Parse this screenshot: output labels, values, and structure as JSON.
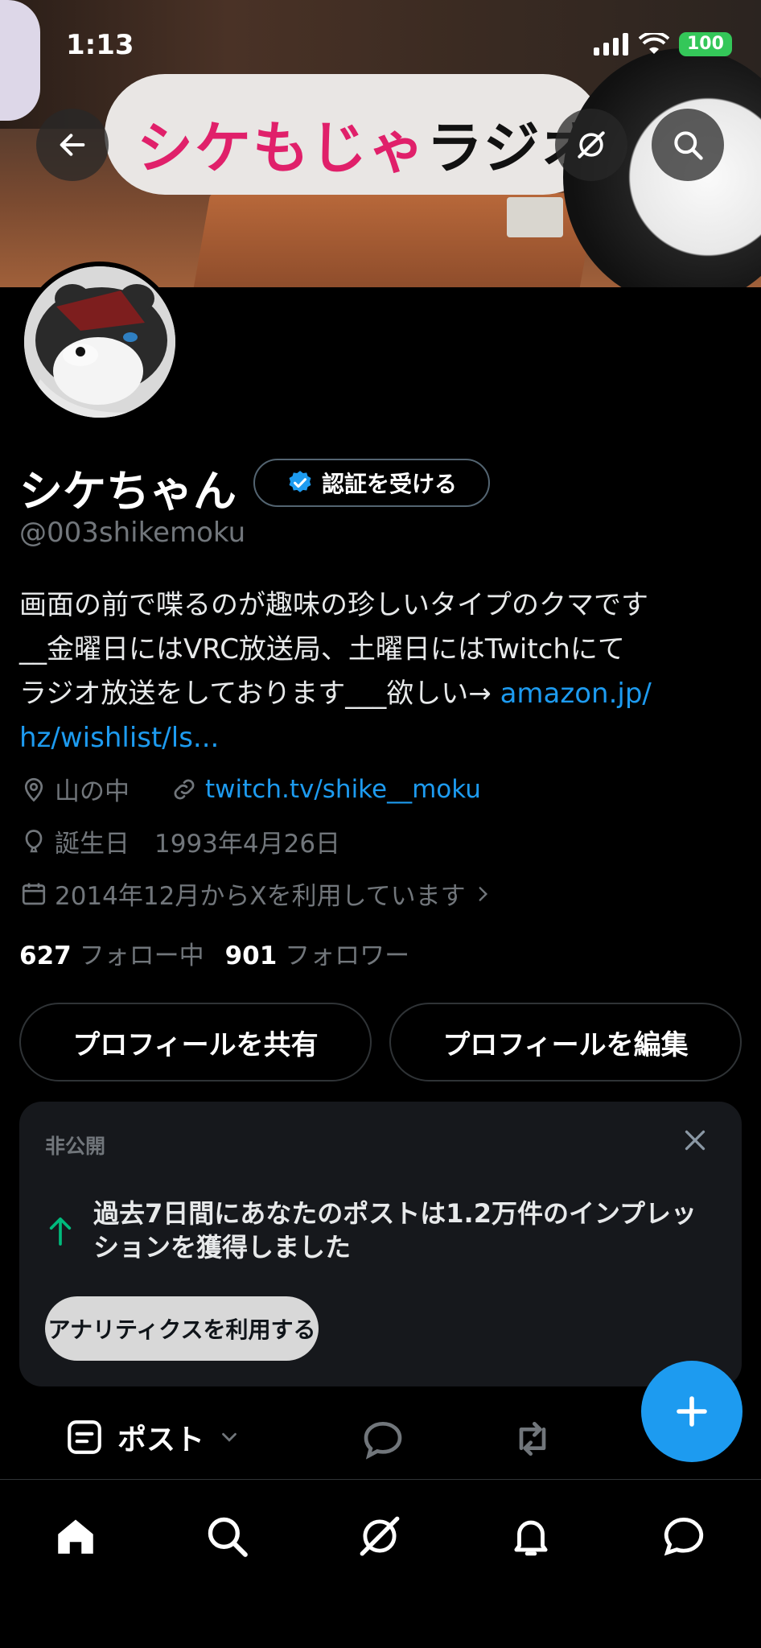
{
  "status_bar": {
    "time": "1:13",
    "battery": "100"
  },
  "banner": {
    "sign_text_pink": "シケもじゃ",
    "sign_text_black": "ラジオ"
  },
  "profile": {
    "name": "シケちゃん",
    "verify_label": "認証を受ける",
    "handle": "@003shikemoku",
    "bio_lines": [
      "画面の前で喋るのが趣味の珍しいタイプのクマです",
      "__金曜日にはVRC放送局、土曜日にはTwitchにて",
      "ラジオ放送をしております___欲しい→ "
    ],
    "bio_link_1": "amazon.jp/",
    "bio_link_2": "hz/wishlist/ls...",
    "location": "山の中",
    "website": "twitch.tv/shike__moku",
    "birthday": "誕生日　1993年4月26日",
    "joined": "2014年12月からXを利用しています",
    "following_count": "627",
    "following_label": "フォロー中",
    "followers_count": "901",
    "followers_label": "フォロワー"
  },
  "actions": {
    "share": "プロフィールを共有",
    "edit": "プロフィールを編集"
  },
  "analytics_card": {
    "title": "非公開",
    "message": "過去7日間にあなたのポストは1.2万件のインプレッションを獲得しました",
    "cta": "アナリティクスを利用する"
  },
  "tabs": {
    "post_label": "ポスト"
  },
  "colors": {
    "accent": "#1d9bf0",
    "positive": "#00ba7c",
    "battery": "#34c759"
  },
  "icons": {
    "back": "back-arrow-icon",
    "grok": "grok-icon",
    "search": "search-icon",
    "verified": "verified-badge-icon",
    "location": "location-icon",
    "link": "link-icon",
    "birthday": "balloon-icon",
    "calendar": "calendar-icon",
    "close": "close-icon",
    "trend": "arrow-up-icon",
    "compose": "plus-icon",
    "home": "home-icon",
    "notifications": "bell-icon",
    "messages": "chat-icon"
  }
}
